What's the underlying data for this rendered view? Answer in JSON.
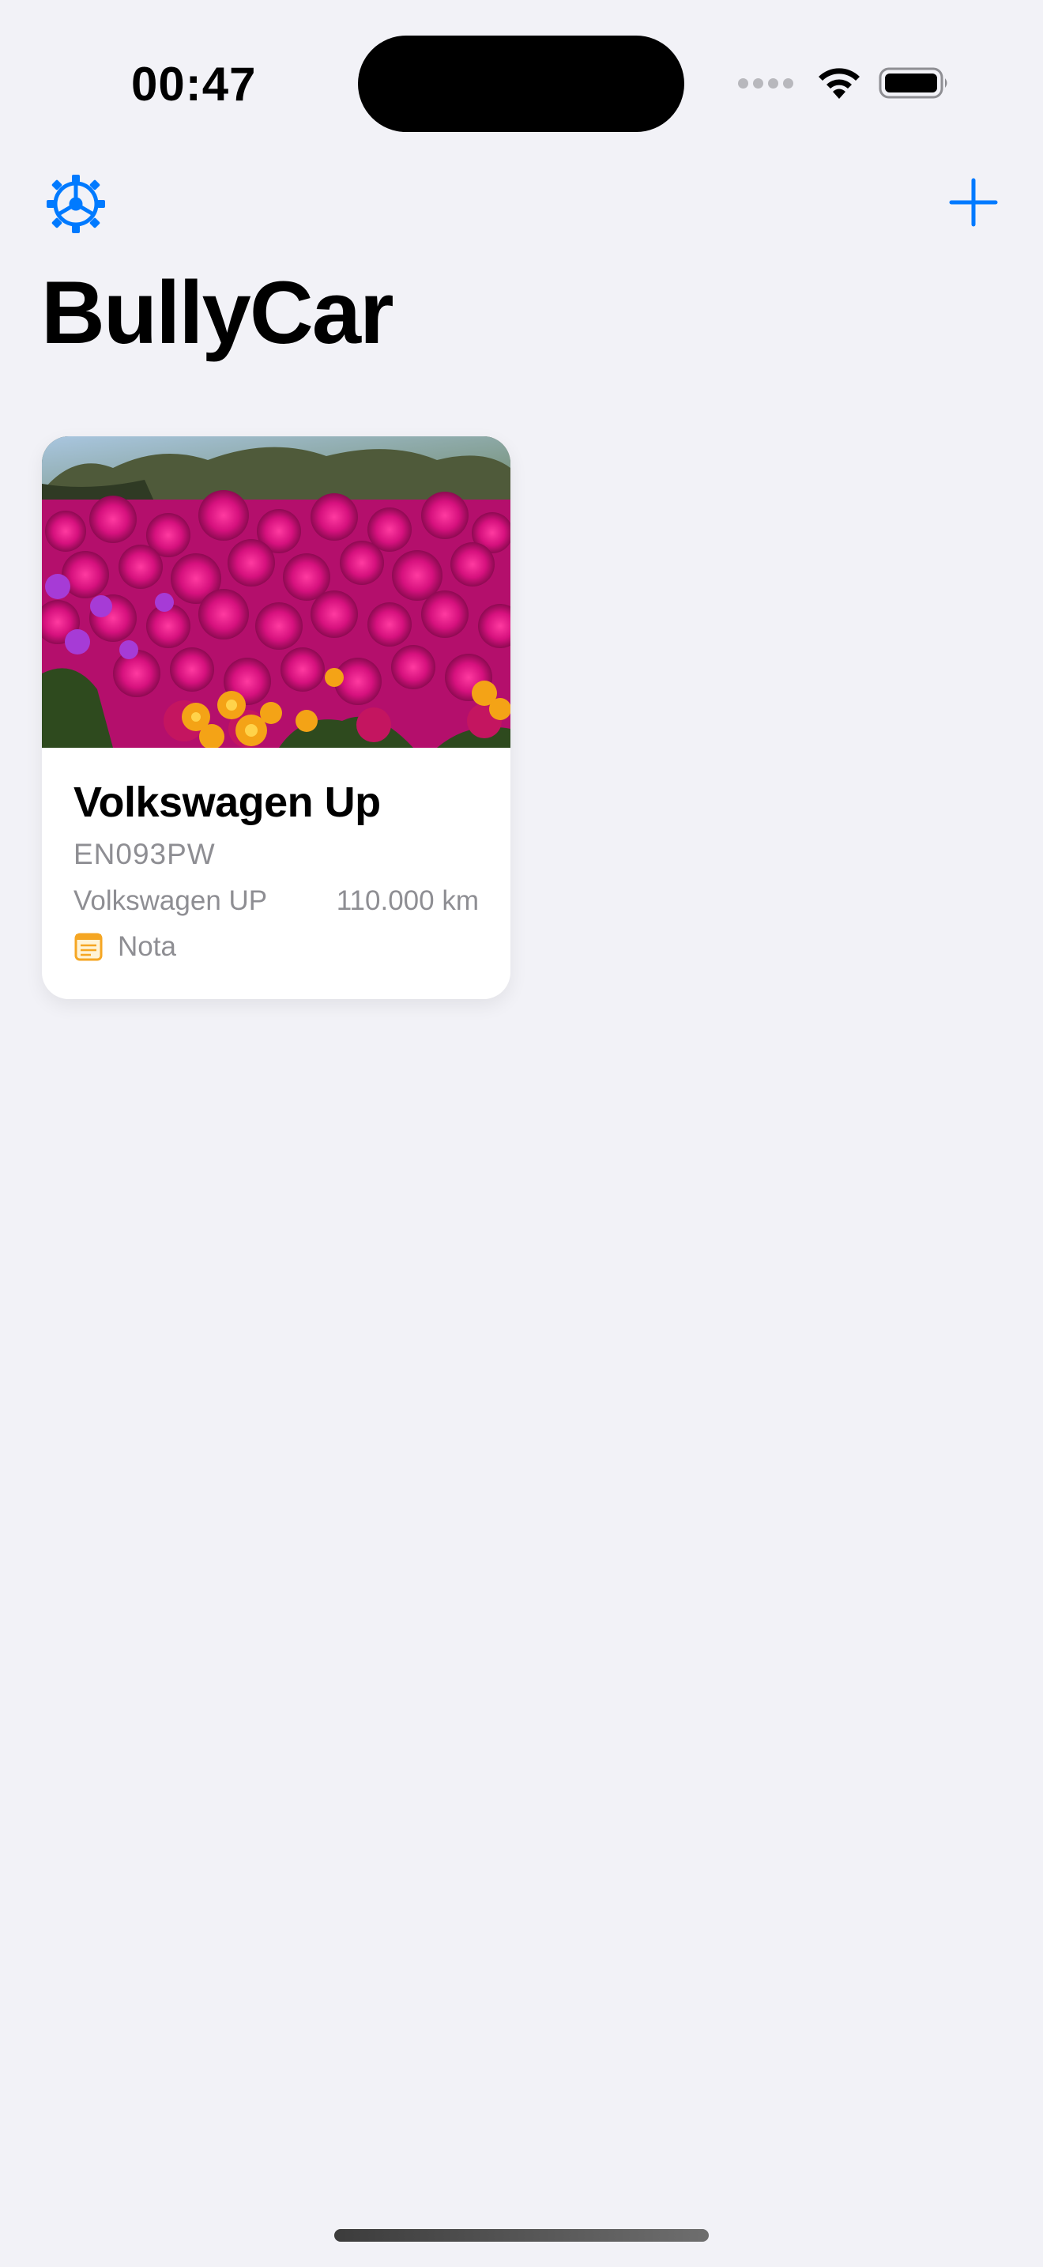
{
  "status_bar": {
    "time": "00:47",
    "icons": [
      "cellular-signal-icon",
      "wifi-icon",
      "battery-icon"
    ]
  },
  "nav": {
    "settings_icon": "gear-icon",
    "add_icon": "plus-icon",
    "accent_color": "#007aff"
  },
  "page": {
    "title": "BullyCar"
  },
  "vehicles": [
    {
      "name": "Volkswagen Up",
      "plate": "EN093PW",
      "model": "Volkswagen UP",
      "mileage": "110.000 km",
      "note_label": "Nota",
      "note_icon": "note-icon",
      "note_icon_color": "#f5a623",
      "photo": "flowers-photo"
    }
  ]
}
